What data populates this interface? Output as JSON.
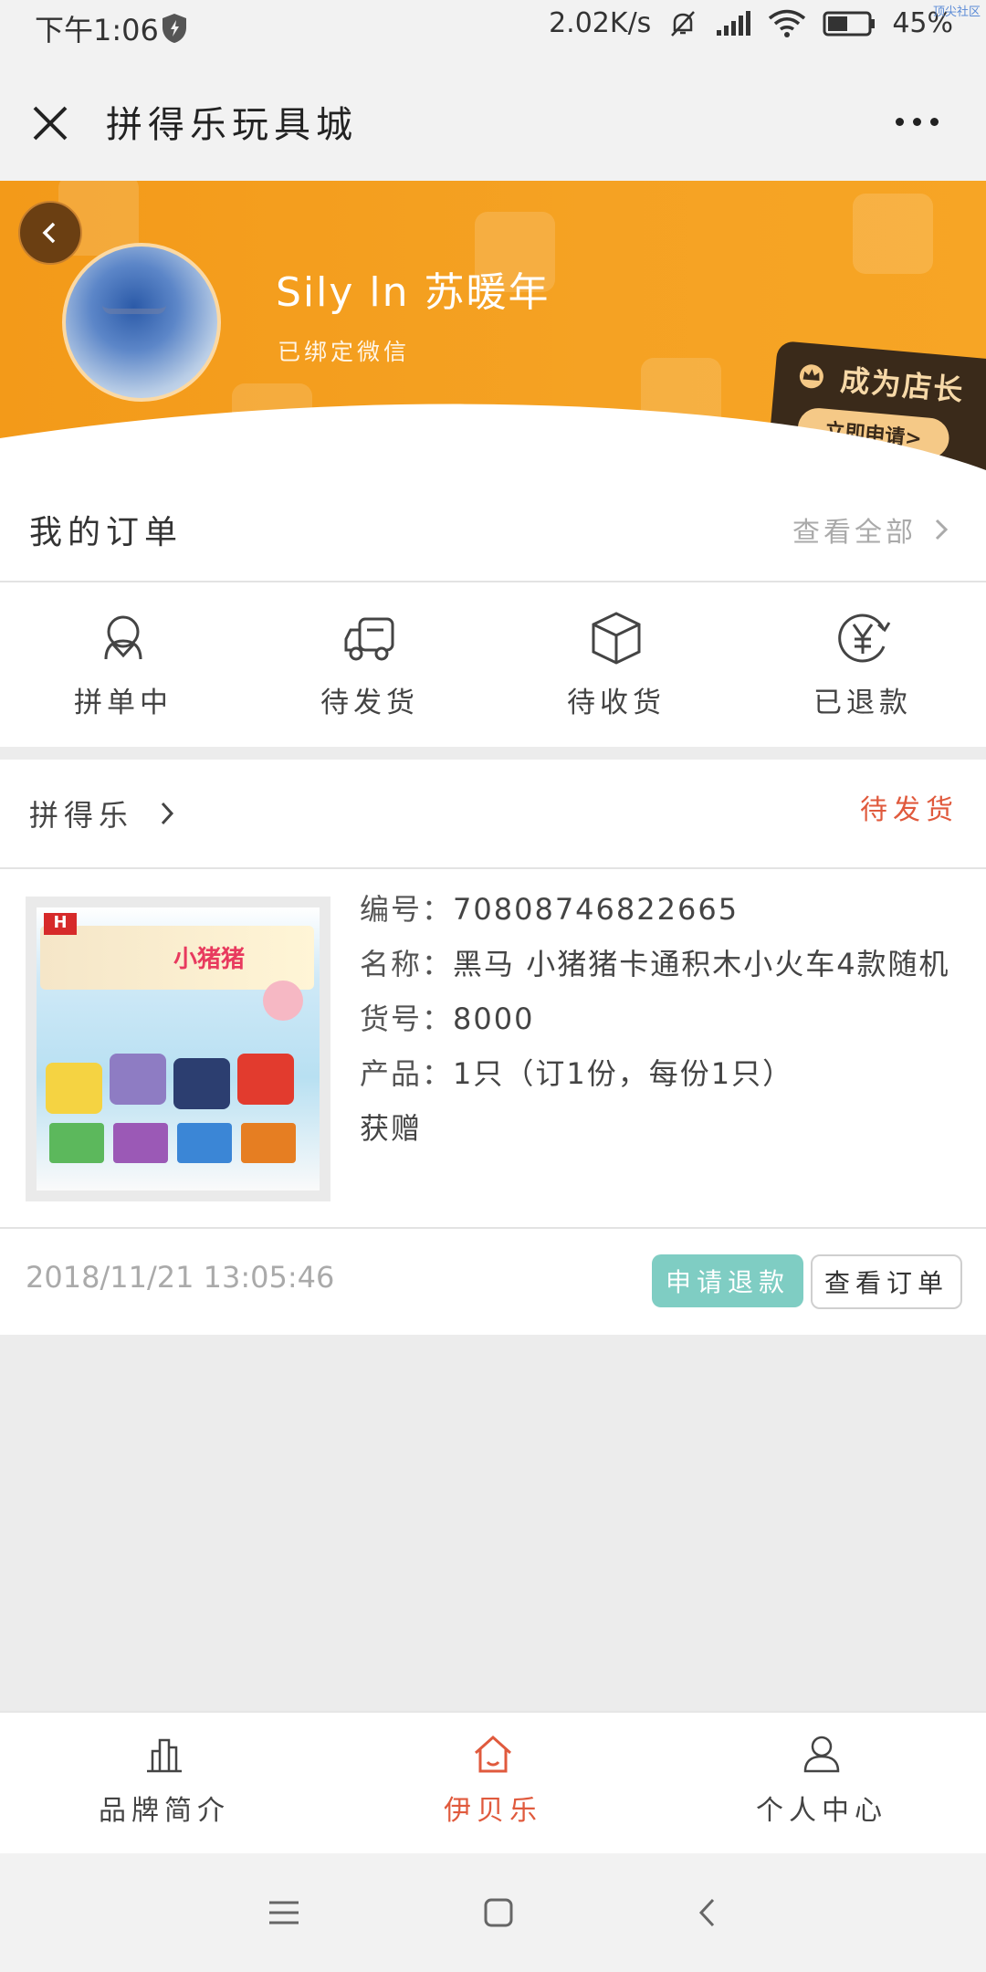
{
  "status_bar": {
    "time": "下午1:06",
    "network_speed": "2.02K/s",
    "battery": "45%"
  },
  "corner_tag": "顶尖社区",
  "title_bar": {
    "title": "拼得乐玩具城"
  },
  "profile": {
    "name": "Sily ln 苏暖年",
    "binding": "已绑定微信",
    "shopkeeper_title": "成为店长",
    "shopkeeper_apply": "立即申请>"
  },
  "orders": {
    "title": "我的订单",
    "view_all": "查看全部",
    "statuses": [
      {
        "label": "拼单中",
        "icon": "group-icon"
      },
      {
        "label": "待发货",
        "icon": "truck-icon"
      },
      {
        "label": "待收货",
        "icon": "box-icon"
      },
      {
        "label": "已退款",
        "icon": "yen-refund-icon"
      }
    ]
  },
  "order": {
    "shop": "拼得乐",
    "state": "待发货",
    "product": {
      "id_key": "编号：",
      "id": "70808746822665",
      "name_key": "名称：",
      "name": "黑马 小猪猪卡通积木小火车4款随机",
      "sku_key": "货号：",
      "sku": "8000",
      "qty_key": "产品：",
      "qty": "1只（订1份，每份1只）",
      "gift": "获赠"
    },
    "time": "2018/11/21 13:05:46",
    "refund_button": "申请退款",
    "view_button": "查看订单"
  },
  "bottom_nav": [
    {
      "label": "品牌简介",
      "icon": "building-icon",
      "active": false
    },
    {
      "label": "伊贝乐",
      "icon": "home-icon",
      "active": true
    },
    {
      "label": "个人中心",
      "icon": "person-icon",
      "active": false
    }
  ],
  "colors": {
    "banner": "#f39a19",
    "accent_red": "#e05a3d",
    "refund_teal": "#7fcdc3"
  }
}
